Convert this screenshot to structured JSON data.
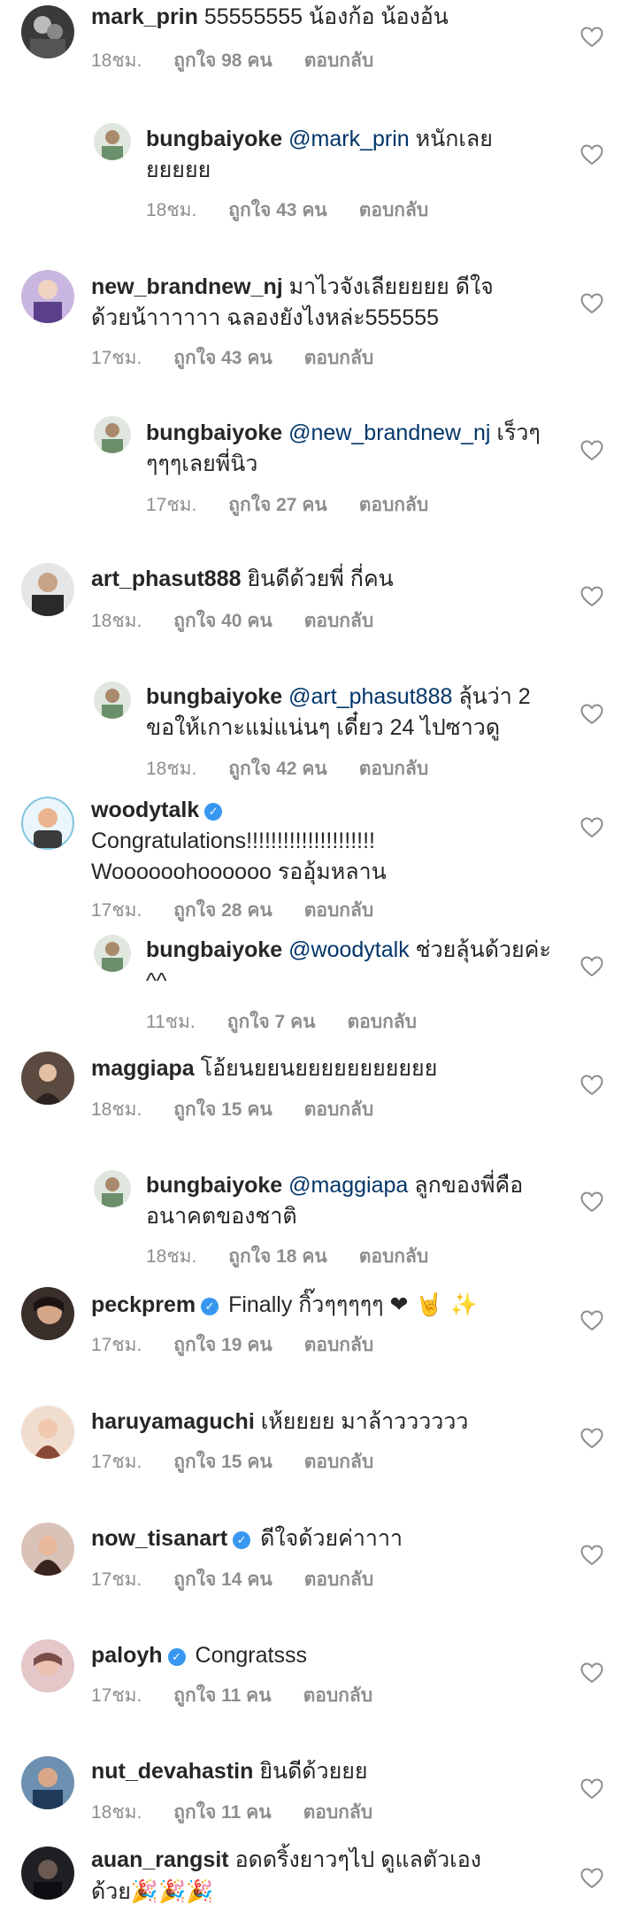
{
  "labels": {
    "reply": "ตอบกลับ",
    "verified_mark": "✓"
  },
  "comments": [
    {
      "user": "mark_prin",
      "text": "55555555 น้องก้อ น้องอ้น",
      "time": "18ชม.",
      "likes": "ถูกใจ 98 คน"
    },
    {
      "user": "bungbaiyoke",
      "mention": "@mark_prin",
      "text": "หนักเลยยยยยย",
      "time": "18ชม.",
      "likes": "ถูกใจ 43 คน"
    },
    {
      "user": "new_brandnew_nj",
      "text": "มาไวจังเลียยยยย ดีใจด้วยน้าาาาาา ฉลองยังไงหล่ะ555555",
      "time": "17ชม.",
      "likes": "ถูกใจ 43 คน"
    },
    {
      "user": "bungbaiyoke",
      "mention": "@new_brandnew_nj",
      "text": "เร็วๆๆๆๆเลยพี่นิว",
      "time": "17ชม.",
      "likes": "ถูกใจ 27 คน"
    },
    {
      "user": "art_phasut888",
      "text": "ยินดีด้วยพี่ กี่คน",
      "time": "18ชม.",
      "likes": "ถูกใจ 40 คน"
    },
    {
      "user": "bungbaiyoke",
      "mention": "@art_phasut888",
      "text": "ลุ้นว่า 2 ขอให้เกาะแม่แน่นๆ เดี๋ยว 24 ไปซาวดู",
      "time": "18ชม.",
      "likes": "ถูกใจ 42 คน"
    },
    {
      "user": "woodytalk",
      "verified": true,
      "text": "Congratulations!!!!!!!!!!!!!!!!!!!!! Woooooohoooooo รออุ้มหลาน",
      "time": "17ชม.",
      "likes": "ถูกใจ 28 คน"
    },
    {
      "user": "bungbaiyoke",
      "mention": "@woodytalk",
      "text": "ช่วยลุ้นด้วยค่ะ ^^",
      "time": "11ชม.",
      "likes": "ถูกใจ 7 คน"
    },
    {
      "user": "maggiapa",
      "text": "โอ้ยนยยนยยยยยยยยยยย",
      "time": "18ชม.",
      "likes": "ถูกใจ 15 คน"
    },
    {
      "user": "bungbaiyoke",
      "mention": "@maggiapa",
      "text": "ลูกของพี่คืออนาคตของชาติ",
      "time": "18ชม.",
      "likes": "ถูกใจ 18 คน"
    },
    {
      "user": "peckprem",
      "verified": true,
      "text": "Finally กิ๊วๆๆๆๆๆ",
      "emoji": "❤ 🤘 ✨",
      "time": "17ชม.",
      "likes": "ถูกใจ 19 คน"
    },
    {
      "user": "haruyamaguchi",
      "text": "เห้ยยยย มาล้าวววววว",
      "time": "17ชม.",
      "likes": "ถูกใจ 15 คน"
    },
    {
      "user": "now_tisanart",
      "verified": true,
      "text": "ดีใจด้วยค่าาาา",
      "time": "17ชม.",
      "likes": "ถูกใจ 14 คน"
    },
    {
      "user": "paloyh",
      "verified": true,
      "text": "Congratsss",
      "time": "17ชม.",
      "likes": "ถูกใจ 11 คน"
    },
    {
      "user": "nut_devahastin",
      "text": "ยินดีด้วยยย",
      "time": "18ชม.",
      "likes": "ถูกใจ 11 คน"
    },
    {
      "user": "auan_rangsit",
      "text": "อดดริ้งยาวๆไป ดูแลตัวเองด้วย",
      "emoji": "🎉🎉🎉"
    }
  ],
  "colors": {
    "username": "#262626",
    "mention": "#003569",
    "meta": "#8e8e8e",
    "verified": "#3897f0",
    "heart_outline": "#8e8e8e"
  }
}
